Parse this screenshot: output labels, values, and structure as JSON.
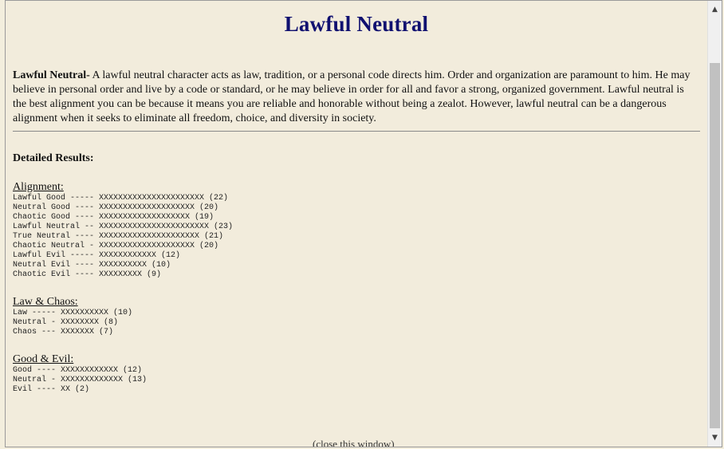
{
  "title": "Lawful Neutral",
  "description": {
    "lead": "Lawful Neutral-",
    "text": " A lawful neutral character acts as law, tradition, or a personal code directs him. Order and organization are paramount to him. He may believe in personal order and live by a code or standard, or he may believe in order for all and favor a strong, organized government. Lawful neutral is the best alignment you can be because it means you are reliable and honorable without being a zealot. However, lawful neutral can be a dangerous alignment when it seeks to eliminate all freedom, choice, and diversity in society."
  },
  "detailed_results_label": "Detailed Results:",
  "alignment": {
    "title": "Alignment:",
    "lines": [
      "Lawful Good ----- XXXXXXXXXXXXXXXXXXXXXX (22)",
      "Neutral Good ---- XXXXXXXXXXXXXXXXXXXX (20)",
      "Chaotic Good ---- XXXXXXXXXXXXXXXXXXX (19)",
      "Lawful Neutral -- XXXXXXXXXXXXXXXXXXXXXXX (23)",
      "True Neutral ---- XXXXXXXXXXXXXXXXXXXXX (21)",
      "Chaotic Neutral - XXXXXXXXXXXXXXXXXXXX (20)",
      "Lawful Evil ----- XXXXXXXXXXXX (12)",
      "Neutral Evil ---- XXXXXXXXXX (10)",
      "Chaotic Evil ---- XXXXXXXXX (9)"
    ]
  },
  "law_chaos": {
    "title": "Law & Chaos:",
    "lines": [
      "Law ----- XXXXXXXXXX (10)",
      "Neutral - XXXXXXXX (8)",
      "Chaos --- XXXXXXX (7)"
    ]
  },
  "good_evil": {
    "title": "Good & Evil:",
    "lines": [
      "Good ---- XXXXXXXXXXXX (12)",
      "Neutral - XXXXXXXXXXXXX (13)",
      "Evil ---- XX (2)"
    ]
  },
  "close_link": "(close this window)",
  "scroll": {
    "up_icon": "▲",
    "down_icon": "▼"
  }
}
